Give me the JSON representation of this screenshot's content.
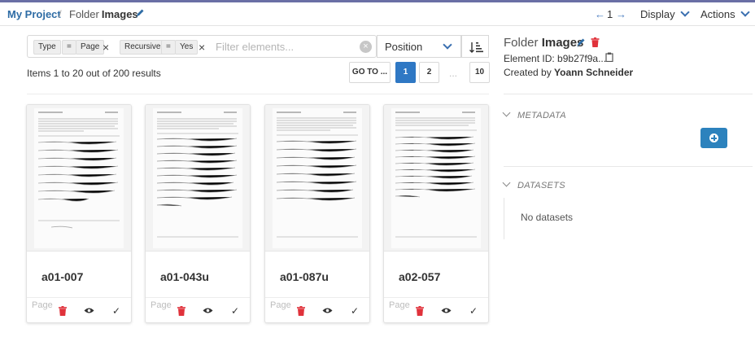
{
  "navbar": {
    "project": "My Project",
    "separator": "/",
    "element_type": "Folder",
    "element_name": "Images",
    "page_number": "1",
    "display_label": "Display",
    "actions_label": "Actions"
  },
  "filters": {
    "tags": [
      {
        "key": "Type",
        "op": "=",
        "value": "Page"
      },
      {
        "key": "Recursive",
        "op": "=",
        "value": "Yes"
      }
    ],
    "placeholder": "Filter elements...",
    "sort_label": "Position"
  },
  "results": {
    "summary": "Items 1 to 20 out of 200 results",
    "goto_label": "GO TO ...",
    "pages": [
      "1",
      "2",
      "10"
    ],
    "ellipsis": "..."
  },
  "cards": [
    {
      "name": "a01-007",
      "type": "Page"
    },
    {
      "name": "a01-043u",
      "type": "Page"
    },
    {
      "name": "a01-087u",
      "type": "Page"
    },
    {
      "name": "a02-057",
      "type": "Page"
    }
  ],
  "details": {
    "type": "Folder",
    "name": "Images",
    "element_id_label": "Element ID:",
    "element_id": "b9b27f9a...",
    "created_by_label": "Created by",
    "creator": "Yoann Schneider",
    "metadata_title": "METADATA",
    "datasets_title": "DATASETS",
    "datasets_empty": "No datasets"
  },
  "colors": {
    "brand_blue": "#2e6ca5",
    "active_page": "#2f78c4",
    "delete_red": "#e0323b",
    "add_button": "#2c82bd"
  }
}
